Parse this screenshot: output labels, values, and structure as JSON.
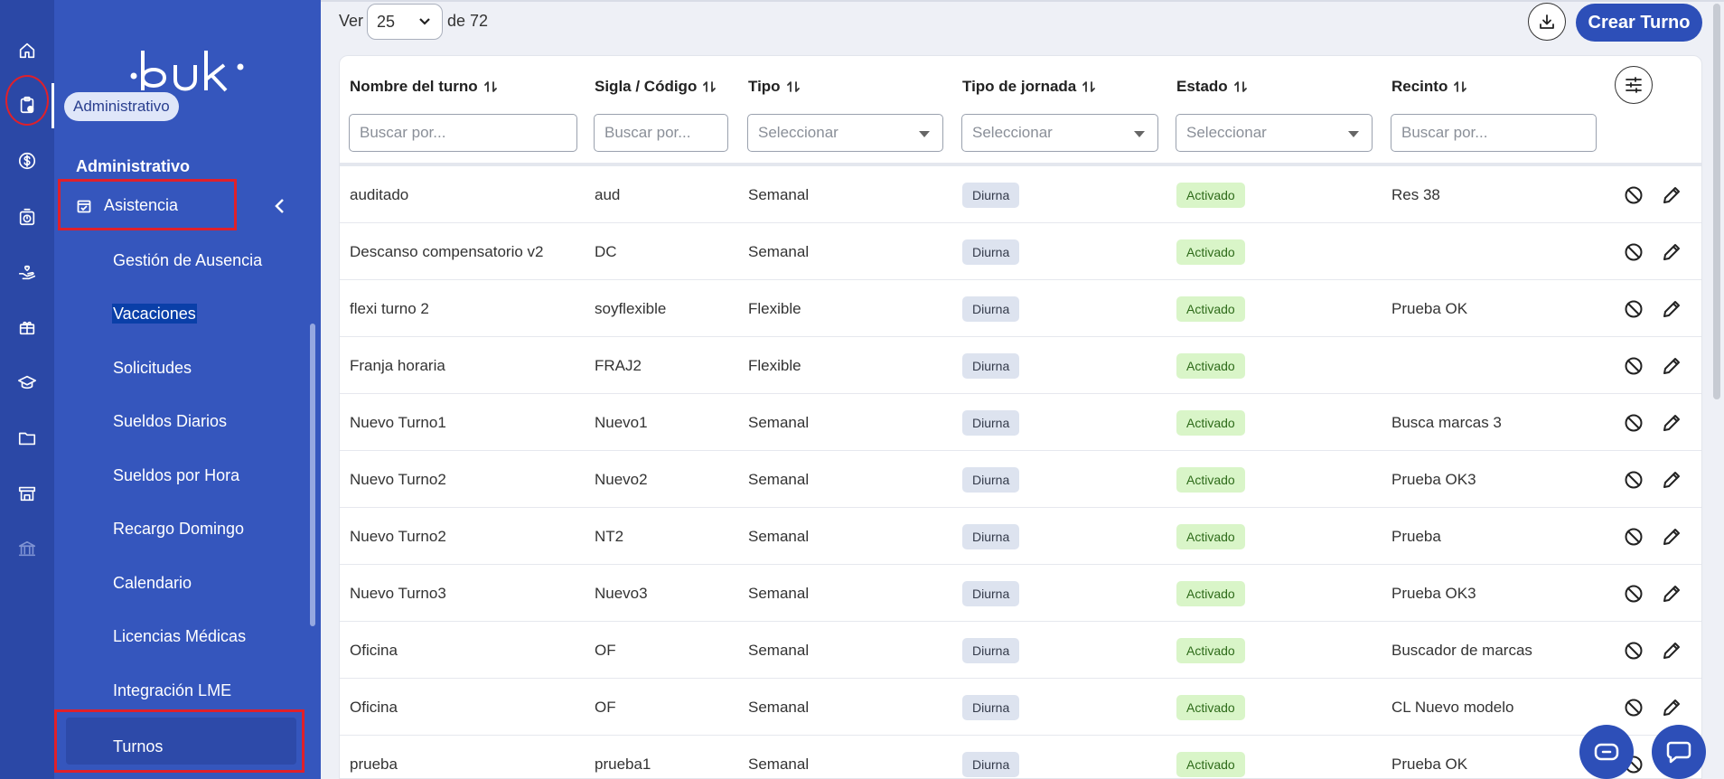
{
  "tooltip": "Administrativo",
  "sidebar": {
    "section_title": "Administrativo",
    "group_label": "Asistencia",
    "items": [
      {
        "label": "Gestión de Ausencia"
      },
      {
        "label": "Vacaciones"
      },
      {
        "label": "Solicitudes"
      },
      {
        "label": "Sueldos Diarios"
      },
      {
        "label": "Sueldos por Hora"
      },
      {
        "label": "Recargo Domingo"
      },
      {
        "label": "Calendario"
      },
      {
        "label": "Licencias Médicas"
      },
      {
        "label": "Integración LME"
      }
    ],
    "active_item": "Turnos"
  },
  "rail_icons": [
    "home-icon",
    "clipboard-icon",
    "dollar-icon",
    "timer-icon",
    "hand-heart-icon",
    "gift-icon",
    "graduation-cap-icon",
    "folder-icon",
    "store-icon",
    "bank-icon"
  ],
  "pager": {
    "ver_label": "Ver",
    "page_size": "25",
    "de_label": "de 72"
  },
  "toolbar": {
    "create_label": "Crear Turno"
  },
  "columns": [
    "Nombre del turno",
    "Sigla / Código",
    "Tipo",
    "Tipo de jornada",
    "Estado",
    "Recinto"
  ],
  "filters": {
    "search_placeholder": "Buscar por...",
    "select_placeholder": "Seleccionar"
  },
  "rows": [
    {
      "name": "auditado",
      "code": "aud",
      "type": "Semanal",
      "jornada": "Diurna",
      "estado": "Activado",
      "recinto": "Res 38"
    },
    {
      "name": "Descanso compensatorio v2",
      "code": "DC",
      "type": "Semanal",
      "jornada": "Diurna",
      "estado": "Activado",
      "recinto": ""
    },
    {
      "name": "flexi turno 2",
      "code": "soyflexible",
      "type": "Flexible",
      "jornada": "Diurna",
      "estado": "Activado",
      "recinto": "Prueba OK"
    },
    {
      "name": "Franja horaria",
      "code": "FRAJ2",
      "type": "Flexible",
      "jornada": "Diurna",
      "estado": "Activado",
      "recinto": ""
    },
    {
      "name": "Nuevo Turno1",
      "code": "Nuevo1",
      "type": "Semanal",
      "jornada": "Diurna",
      "estado": "Activado",
      "recinto": "Busca marcas 3"
    },
    {
      "name": "Nuevo Turno2",
      "code": "Nuevo2",
      "type": "Semanal",
      "jornada": "Diurna",
      "estado": "Activado",
      "recinto": "Prueba OK3"
    },
    {
      "name": "Nuevo Turno2",
      "code": "NT2",
      "type": "Semanal",
      "jornada": "Diurna",
      "estado": "Activado",
      "recinto": "Prueba"
    },
    {
      "name": "Nuevo Turno3",
      "code": "Nuevo3",
      "type": "Semanal",
      "jornada": "Diurna",
      "estado": "Activado",
      "recinto": "Prueba OK3"
    },
    {
      "name": "Oficina",
      "code": "OF",
      "type": "Semanal",
      "jornada": "Diurna",
      "estado": "Activado",
      "recinto": "Buscador de marcas"
    },
    {
      "name": "Oficina",
      "code": "OF",
      "type": "Semanal",
      "jornada": "Diurna",
      "estado": "Activado",
      "recinto": "CL Nuevo modelo"
    },
    {
      "name": "prueba",
      "code": "prueba1",
      "type": "Semanal",
      "jornada": "Diurna",
      "estado": "Activado",
      "recinto": "Prueba OK"
    }
  ],
  "colors": {
    "brand": "#3556bd",
    "rail": "#2b48a6",
    "primary_button": "#2d4fb8",
    "annotation_red": "#e0202a",
    "badge_active_bg": "#d9f5c8"
  }
}
